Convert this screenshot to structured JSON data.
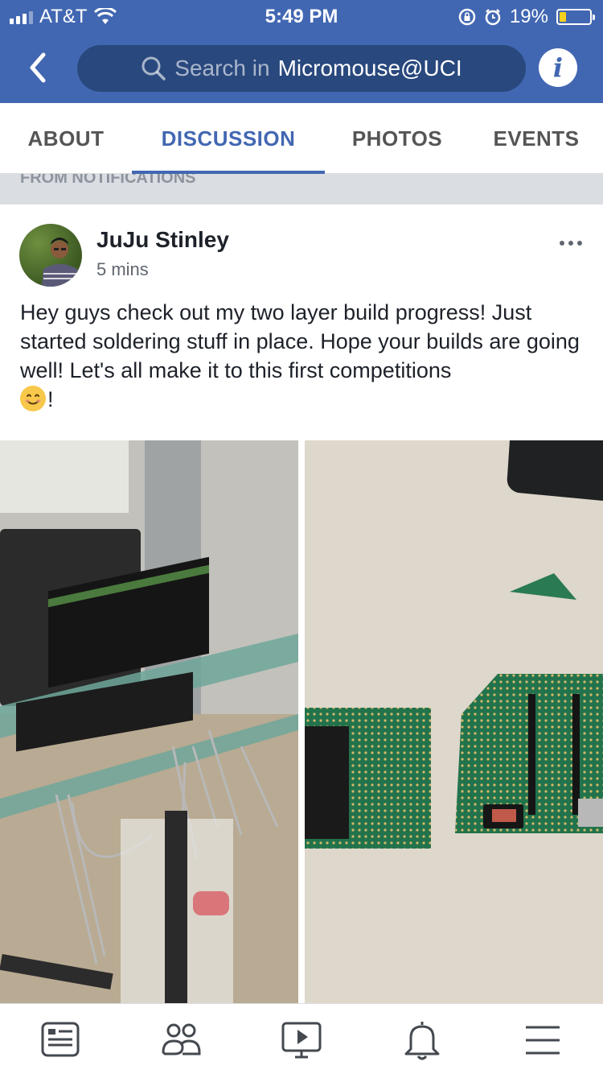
{
  "status": {
    "carrier": "AT&T",
    "time": "5:49 PM",
    "battery": "19%",
    "battery_level": 0.19
  },
  "search": {
    "prefix": "Search in",
    "group": "Micromouse@UCI"
  },
  "tabs": [
    {
      "label": "ABOUT",
      "active": false
    },
    {
      "label": "DISCUSSION",
      "active": true
    },
    {
      "label": "PHOTOS",
      "active": false
    },
    {
      "label": "EVENTS",
      "active": false
    }
  ],
  "notification_label": "FROM NOTIFICATIONS",
  "post": {
    "author": "JuJu Stinley",
    "time_ago": "5 mins",
    "text": "Hey guys check out my two layer build progress! Just started soldering stuff in place. Hope your builds are going well! Let's all make it to this first competitions",
    "text_suffix": "!"
  },
  "bottom_nav": [
    "news-feed-icon",
    "groups-icon",
    "video-icon",
    "notifications-icon",
    "menu-icon"
  ],
  "colors": {
    "brand": "#4267b2",
    "search_bg": "#29487d"
  }
}
